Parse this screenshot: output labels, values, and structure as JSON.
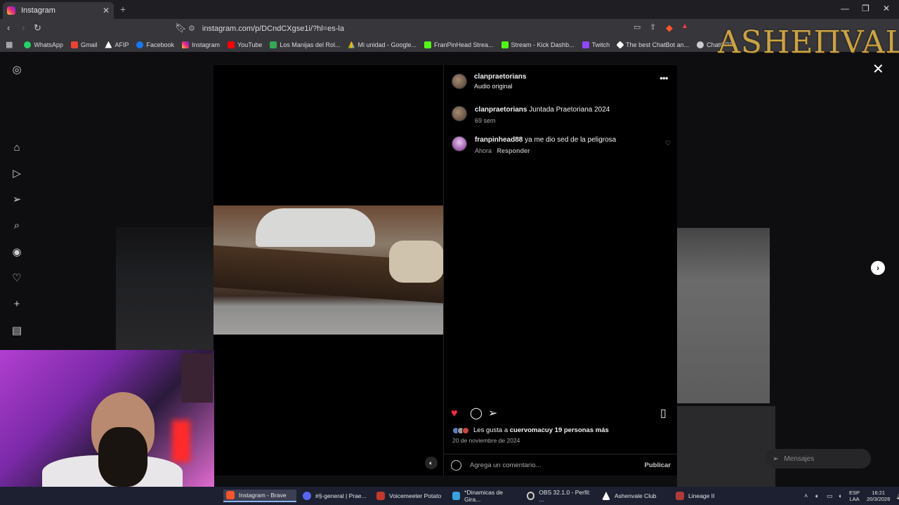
{
  "browser": {
    "tab_title": "Instagram",
    "new_tab": "+",
    "url": "instagram.com/p/DCndCXgse1i/?hl=es-la",
    "window_controls": [
      "—",
      "❐",
      "✕"
    ],
    "bookmarks": [
      {
        "label": "WhatsApp",
        "color": "#25d366"
      },
      {
        "label": "Gmail",
        "color": "#ea4335"
      },
      {
        "label": "AFIP",
        "color": "#ffffff"
      },
      {
        "label": "Facebook",
        "color": "#1877f2"
      },
      {
        "label": "Instagram",
        "color": "#e1306c"
      },
      {
        "label": "YouTube",
        "color": "#ff0000"
      },
      {
        "label": "Los Manijas del Rol...",
        "color": "#34a853"
      },
      {
        "label": "Mi unidad - Google...",
        "color": "#fbbc04"
      },
      {
        "label": "FranPinHead Strea...",
        "color": "#53fc18"
      },
      {
        "label": "Stream - Kick Dashb...",
        "color": "#53fc18"
      },
      {
        "label": "Twitch",
        "color": "#9146ff"
      },
      {
        "label": "The best ChatBot an...",
        "color": "#ffffff"
      },
      {
        "label": "ChatGPT",
        "color": "#cccccc"
      }
    ]
  },
  "overlay_logo": "ASHEПVALE",
  "post": {
    "author": "clanpraetorians",
    "audio": "Audio original",
    "caption_user": "clanpraetorians",
    "caption_text": "Juntada Praetoriana 2024",
    "caption_time": "69 sem",
    "comment_user": "franpinhead88",
    "comment_text": "ya me dio sed de la peligrosa",
    "comment_time": "Ahora",
    "comment_reply": "Responder",
    "likes_prefix": "Les gusta a ",
    "likes_user": "cuervomacu",
    "likes_suffix": " y 19 personas más",
    "date": "20 de noviembre de 2024",
    "comment_placeholder": "Agrega un comentario...",
    "publish": "Publicar"
  },
  "messages_label": "Mensajes",
  "taskbar": {
    "apps": [
      {
        "label": "Instagram - Brave",
        "color": "#fb542b",
        "active": true
      },
      {
        "label": "#§-general | Prae...",
        "color": "#5865f2",
        "active": false
      },
      {
        "label": "Voicemeeter Potato",
        "color": "#c0392b",
        "active": false
      },
      {
        "label": "*Dinamicas de Gira...",
        "color": "#3aa0e0",
        "active": false
      },
      {
        "label": "OBS 32.1.0 - Perfil: ...",
        "color": "#cccccc",
        "active": false
      },
      {
        "label": "Ashenvale Club",
        "color": "#ffffff",
        "active": false
      },
      {
        "label": "Lineage II",
        "color": "#b03a3a",
        "active": false
      }
    ],
    "lang_top": "ESP",
    "lang_bottom": "LAA",
    "time": "16:21",
    "date": "20/3/2026"
  },
  "colors": {
    "like_red": "#ff3040",
    "accent": "#0095f6"
  }
}
